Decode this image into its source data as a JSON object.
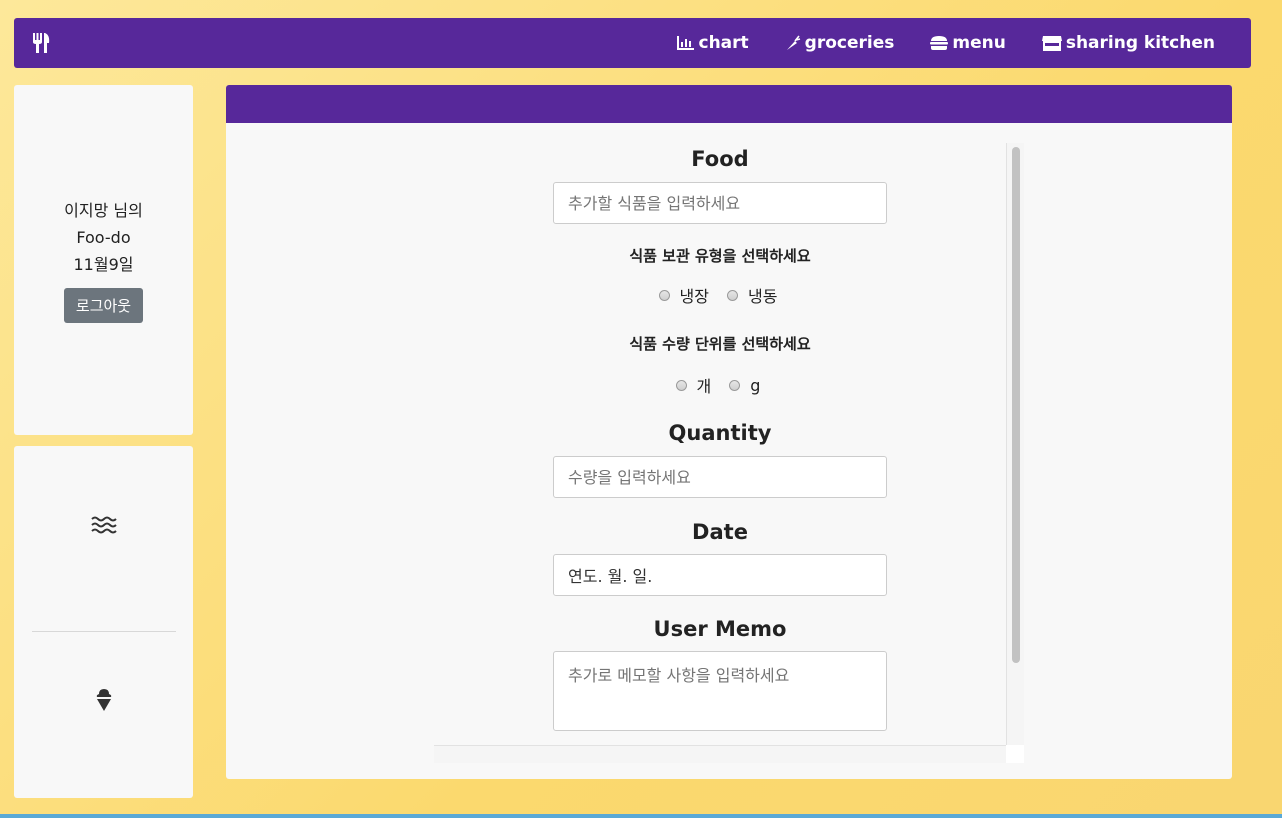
{
  "navbar": {
    "brand_icon": "utensils-icon",
    "links": [
      {
        "label": "chart",
        "icon": "chart-icon"
      },
      {
        "label": "groceries",
        "icon": "carrot-icon"
      },
      {
        "label": "menu",
        "icon": "hamburger-icon"
      },
      {
        "label": "sharing kitchen",
        "icon": "store-icon"
      }
    ]
  },
  "profile": {
    "line1": "이지망 님의",
    "line2": "Foo-do",
    "line3": "11월9일",
    "logout_label": "로그아웃"
  },
  "tools": {
    "icons": [
      "water-icon",
      "ice-cream-icon"
    ]
  },
  "form": {
    "food_title": "Food",
    "food_placeholder": "추가할 식품을 입력하세요",
    "storage_title": "식품 보관 유형을 선택하세요",
    "storage_options": [
      "냉장",
      "냉동"
    ],
    "unit_title": "식품 수량 단위를 선택하세요",
    "unit_options": [
      "개",
      "g"
    ],
    "quantity_title": "Quantity",
    "quantity_placeholder": "수량을 입력하세요",
    "date_title": "Date",
    "date_value": "연도. 월. 일.",
    "memo_title": "User Memo",
    "memo_placeholder": "추가로 메모할 사항을 입력하세요"
  },
  "colors": {
    "nav_bg": "#57289a",
    "page_bg": "#fbd96e",
    "card_bg": "#f8f8f8",
    "logout_bg": "#6c757d"
  }
}
